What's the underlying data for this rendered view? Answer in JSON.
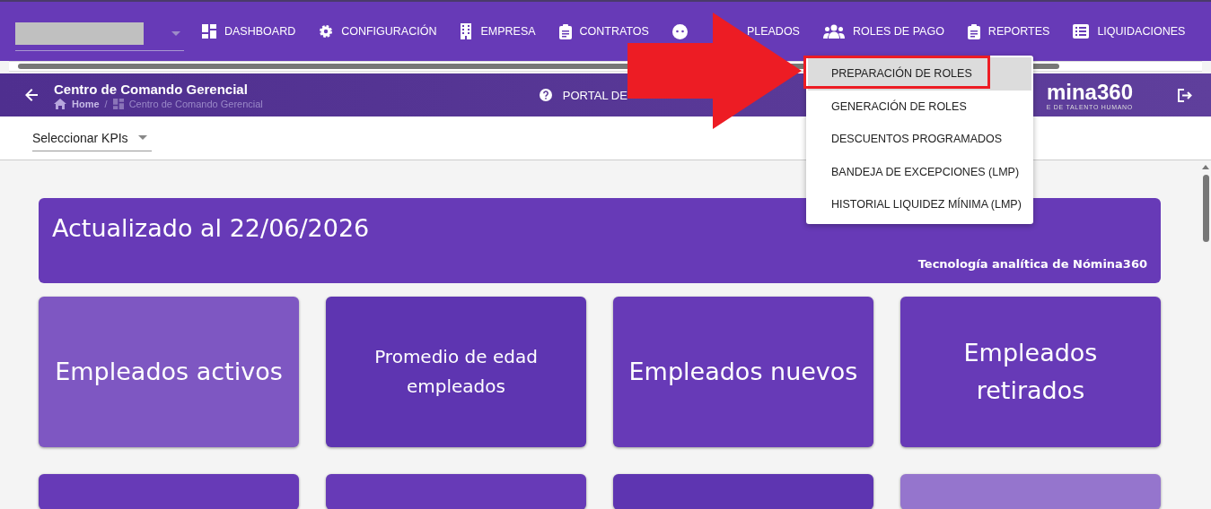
{
  "nav": {
    "items": [
      {
        "kind": "grid",
        "label": "DASHBOARD"
      },
      {
        "kind": "gear",
        "label": "CONFIGURACIÓN"
      },
      {
        "kind": "building",
        "label": "EMPRESA"
      },
      {
        "kind": "clipboard",
        "label": "CONTRATOS"
      },
      {
        "kind": "face",
        "label": "PLEADOS"
      },
      {
        "kind": "people",
        "label": "ROLES DE PAGO"
      },
      {
        "kind": "clipboard",
        "label": "REPORTES"
      },
      {
        "kind": "list",
        "label": "LIQUIDACIONES"
      }
    ]
  },
  "header": {
    "title": "Centro de Comando Gerencial",
    "breadcrumb": [
      "Home",
      "Centro de Comando Gerencial"
    ],
    "breadcrumb_separator": "/",
    "portal": "PORTAL DE",
    "logo": "mina360",
    "logo_tagline": "E DE TALENTO HUMANO"
  },
  "toolbar": {
    "kpi_select": "Seleccionar KPIs"
  },
  "banner": {
    "title": "Actualizado al 22/06/2026",
    "footer": "Tecnología analítica de Nómina360"
  },
  "cards": [
    {
      "label": "Empleados activos",
      "kind": "large",
      "color": "#7e57c2"
    },
    {
      "label": "Promedio de edad empleados",
      "kind": "small",
      "color": "#5e35b1"
    },
    {
      "label": "Empleados nuevos",
      "kind": "large",
      "color": "#673ab7"
    },
    {
      "label": "Empleados retirados",
      "kind": "large",
      "color": "#673ab7"
    },
    {
      "color": "#673ab7"
    },
    {
      "color": "#673ab7"
    },
    {
      "color": "#5e35b1"
    },
    {
      "color": "#9575cd"
    }
  ],
  "menu": {
    "items": [
      {
        "label": "PREPARACIÓN DE ROLES",
        "selected": true
      },
      {
        "label": "GENERACIÓN DE ROLES",
        "selected": false
      },
      {
        "label": "DESCUENTOS PROGRAMADOS",
        "selected": false
      },
      {
        "label": "BANDEJA DE EXCEPCIONES (LMP)",
        "selected": false
      },
      {
        "label": "HISTORIAL LIQUIDEZ MÍNIMA (LMP)",
        "selected": false
      }
    ]
  }
}
